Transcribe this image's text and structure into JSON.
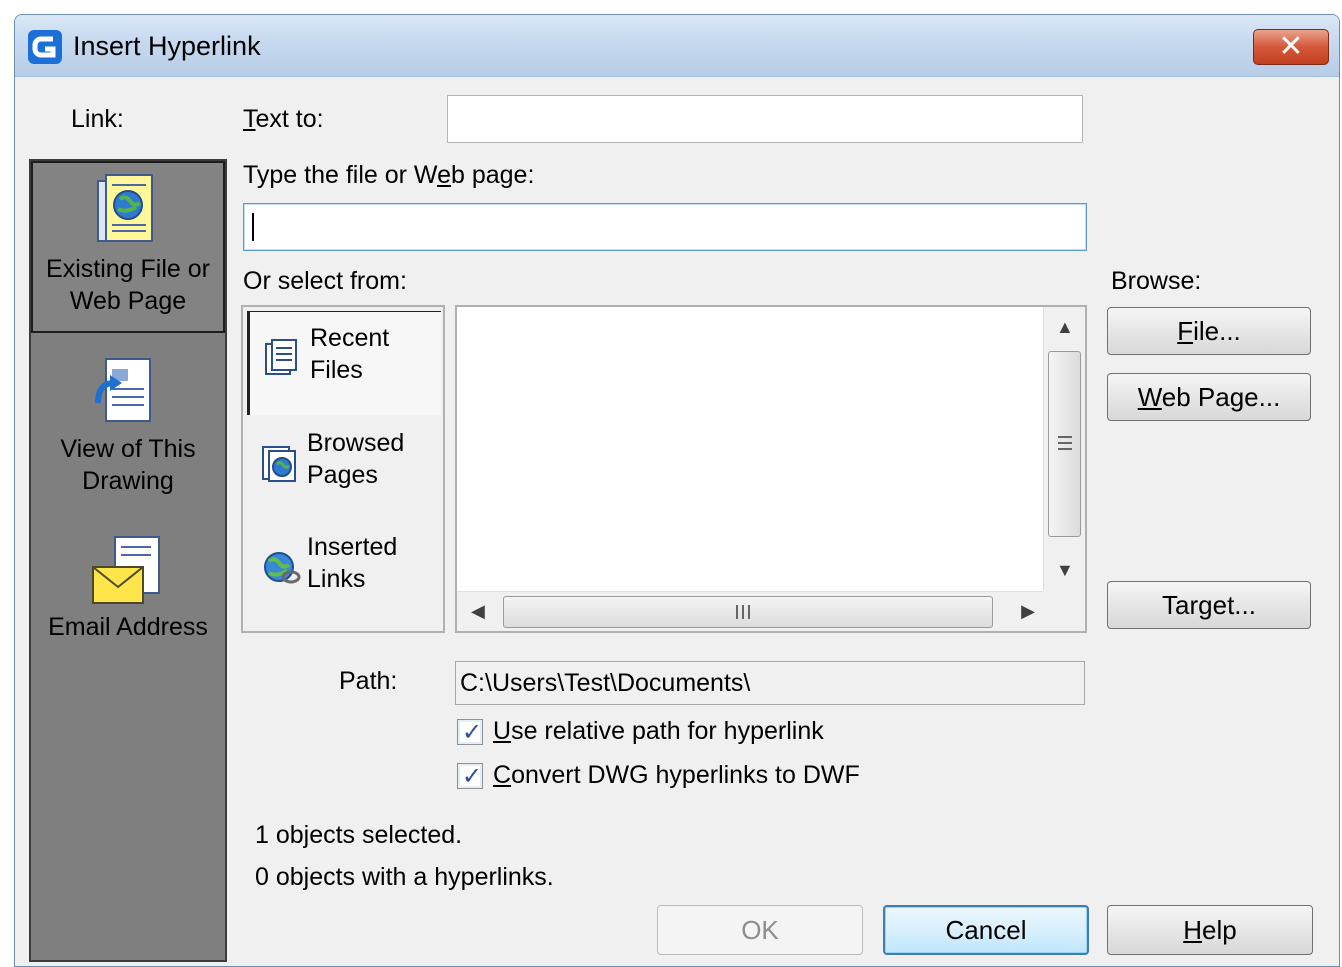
{
  "window": {
    "title": "Insert Hyperlink",
    "close_symbol": "✕"
  },
  "link_bar": {
    "label": "Link:",
    "items": [
      {
        "line1": "Existing File or",
        "line2": "Web Page",
        "icon": "existing-file-icon",
        "selected": true
      },
      {
        "line1": "View of This",
        "line2": "Drawing",
        "icon": "view-drawing-icon",
        "selected": false
      },
      {
        "line1": "Email Address",
        "line2": "",
        "icon": "email-icon",
        "selected": false
      }
    ]
  },
  "text_to": {
    "label_pre": "",
    "label_u": "T",
    "label_post": "ext to:",
    "value": ""
  },
  "web_page": {
    "label_pre": "Type the file or W",
    "label_u": "e",
    "label_post": "b page:",
    "value": ""
  },
  "select_from": {
    "label": "Or select from:",
    "sources": [
      {
        "line1": "Recent",
        "line2": "Files",
        "icon": "recent-files-icon"
      },
      {
        "line1": "Browsed",
        "line2": "Pages",
        "icon": "browsed-pages-icon"
      },
      {
        "line1": "Inserted",
        "line2": "Links",
        "icon": "inserted-links-icon"
      }
    ],
    "files": []
  },
  "browse": {
    "label": "Browse:",
    "file_pre": "",
    "file_u": "F",
    "file_post": "ile...",
    "web_pre": "",
    "web_u": "W",
    "web_post": "eb Page...",
    "target_pre": "Tar",
    "target_u": "g",
    "target_post": "et..."
  },
  "path": {
    "label": "Path:",
    "value": "C:\\Users\\Test\\Documents\\"
  },
  "options": {
    "relative_pre": "",
    "relative_u": "U",
    "relative_post": "se relative path for hyperlink",
    "relative_checked": true,
    "convert_pre": "",
    "convert_u": "C",
    "convert_post": "onvert DWG hyperlinks to DWF",
    "convert_checked": true
  },
  "status": {
    "selected": "1 objects selected.",
    "with_links": "0 objects with a hyperlinks."
  },
  "buttons": {
    "ok": "OK",
    "cancel": "Cancel",
    "help_pre": "",
    "help_u": "H",
    "help_post": "elp"
  }
}
